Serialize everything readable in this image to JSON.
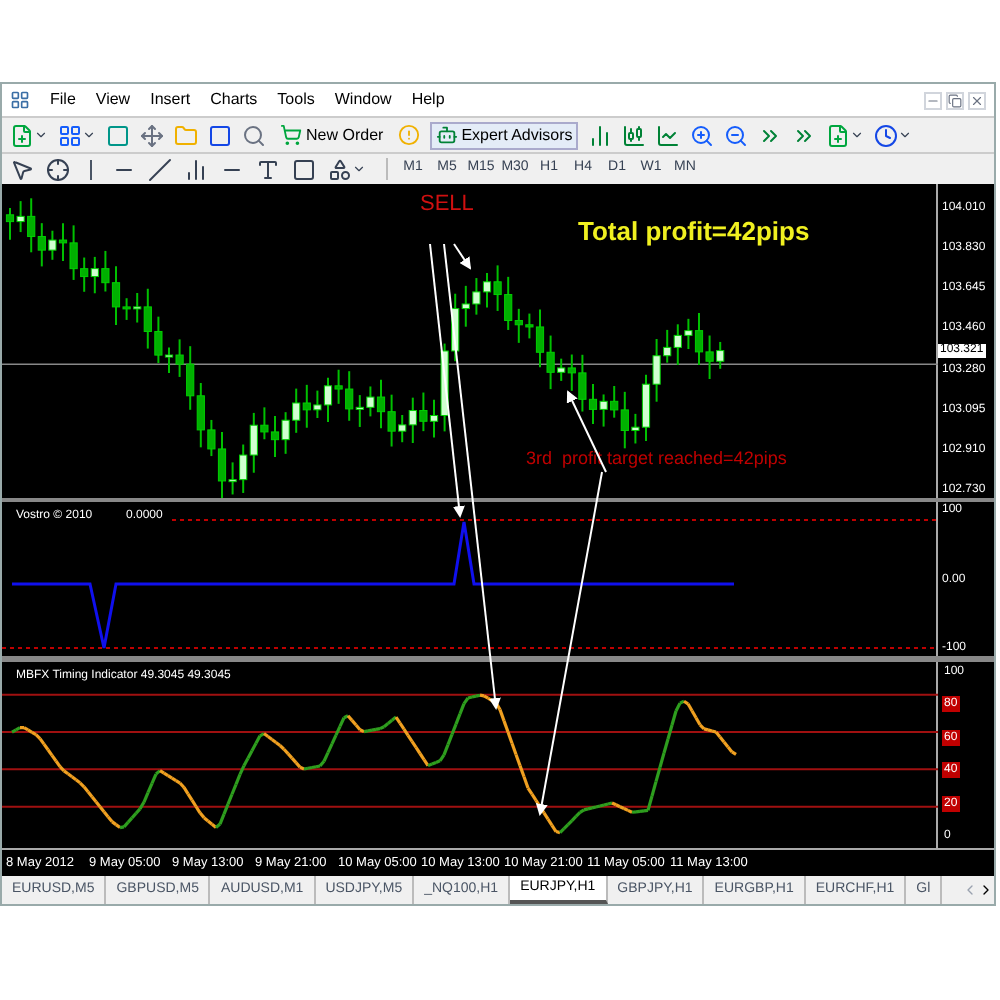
{
  "menu": [
    "File",
    "View",
    "Insert",
    "Charts",
    "Tools",
    "Window",
    "Help"
  ],
  "toolbar": {
    "new_order": "New Order",
    "expert_advisors": "Expert Advisors"
  },
  "timeframes": [
    "M1",
    "M5",
    "M15",
    "M30",
    "H1",
    "H4",
    "D1",
    "W1",
    "MN"
  ],
  "main_chart": {
    "price_labels": [
      "104.010",
      "103.830",
      "103.645",
      "103.460",
      "103.280",
      "103.095",
      "102.910",
      "102.730"
    ],
    "current_price": "103.321",
    "annotations": [
      {
        "kind": "signal",
        "text": "SELL"
      },
      {
        "kind": "headline",
        "text": "Total profit=42pips"
      },
      {
        "kind": "note",
        "text": "3rd  profit target reached=42pips"
      }
    ]
  },
  "vostro": {
    "label": "Vostro © 2010",
    "value": "0.0000",
    "axis_labels": [
      "100",
      "0.00",
      "-100"
    ]
  },
  "mbfx": {
    "label": "MBFX Timing Indicator 49.3045 49.3045",
    "axis_labels": [
      {
        "text": "100",
        "highlighted": false
      },
      {
        "text": "80",
        "highlighted": true
      },
      {
        "text": "60",
        "highlighted": true
      },
      {
        "text": "40",
        "highlighted": true
      },
      {
        "text": "20",
        "highlighted": true
      },
      {
        "text": "0",
        "highlighted": false
      }
    ]
  },
  "time_axis": [
    "8 May 2012",
    "9 May 05:00",
    "9 May 13:00",
    "9 May 21:00",
    "10 May 05:00",
    "10 May 13:00",
    "10 May 21:00",
    "11 May 05:00",
    "11 May 13:00"
  ],
  "tabs": [
    {
      "label": "EURUSD,M5",
      "selected": false
    },
    {
      "label": "GBPUSD,M5",
      "selected": false
    },
    {
      "label": "AUDUSD,M1",
      "selected": false
    },
    {
      "label": "USDJPY,M5",
      "selected": false
    },
    {
      "label": "_NQ100,H1",
      "selected": false
    },
    {
      "label": "EURJPY,H1",
      "selected": true
    },
    {
      "label": "GBPJPY,H1",
      "selected": false
    },
    {
      "label": "EURGBP,H1",
      "selected": false
    },
    {
      "label": "EURCHF,H1",
      "selected": false
    },
    {
      "label": "Gl",
      "selected": false
    }
  ]
}
